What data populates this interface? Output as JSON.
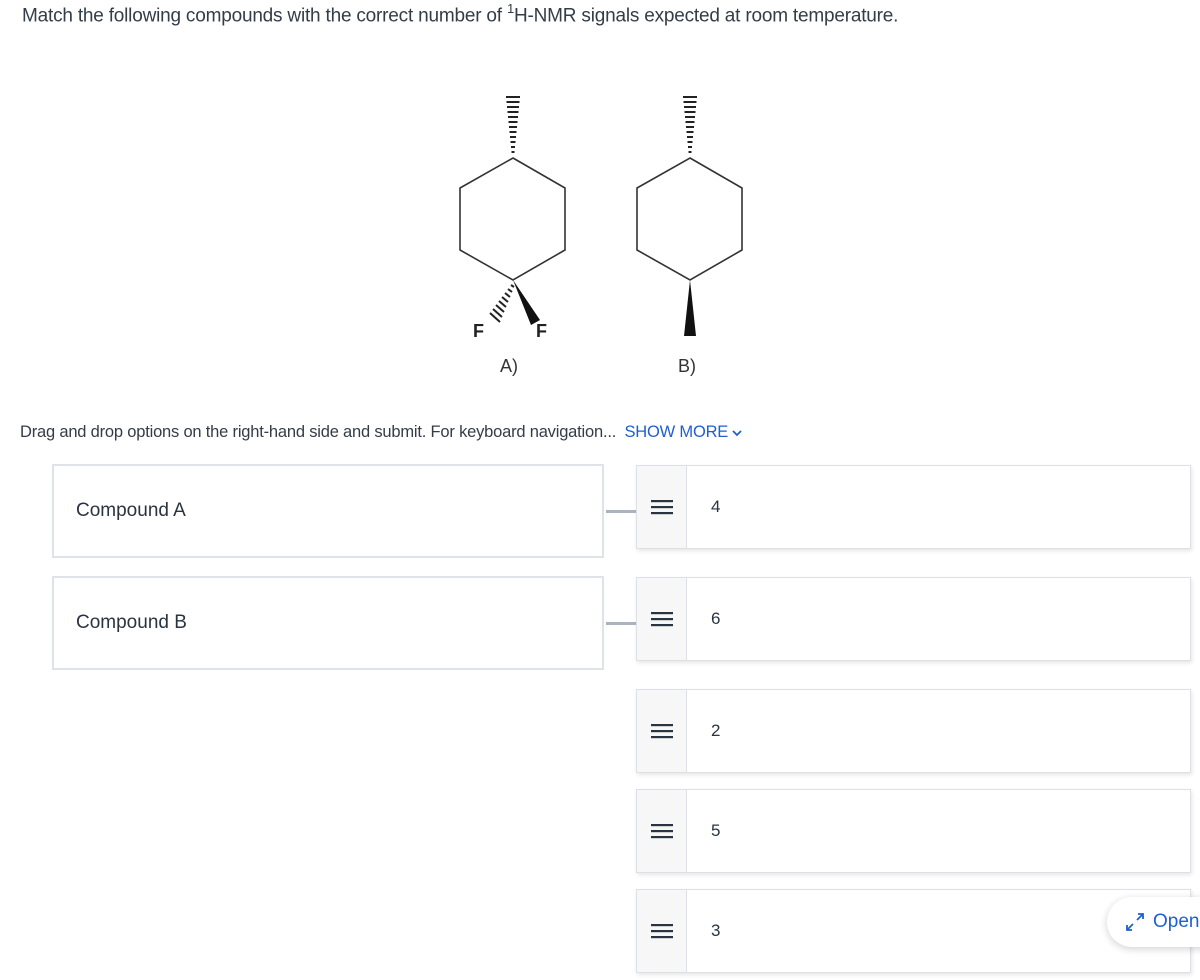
{
  "question": {
    "prefix": "Match the following compounds with the correct number of ",
    "superscript": "1",
    "suffix": "H-NMR signals expected at room temperature."
  },
  "figure": {
    "compounds": [
      {
        "label": "A)",
        "substituents": [
          "F",
          "F"
        ]
      },
      {
        "label": "B)"
      }
    ]
  },
  "instructions": {
    "text": "Drag and drop options on the right-hand side and submit. For keyboard navigation...",
    "show_more_label": "SHOW MORE"
  },
  "targets": [
    {
      "label": "Compound A"
    },
    {
      "label": "Compound B"
    }
  ],
  "options": [
    {
      "value": "4",
      "icon": "drag-handle-icon"
    },
    {
      "value": "6",
      "icon": "drag-handle-icon"
    },
    {
      "value": "2",
      "icon": "drag-handle-icon"
    },
    {
      "value": "5",
      "icon": "drag-handle-icon"
    },
    {
      "value": "3",
      "icon": "drag-handle-icon"
    }
  ],
  "open_button": {
    "label": "Open",
    "icon": "expand-arrows-icon"
  },
  "colors": {
    "accent": "#1f5fd1",
    "text": "#333d47",
    "border": "#dfe3e8"
  }
}
